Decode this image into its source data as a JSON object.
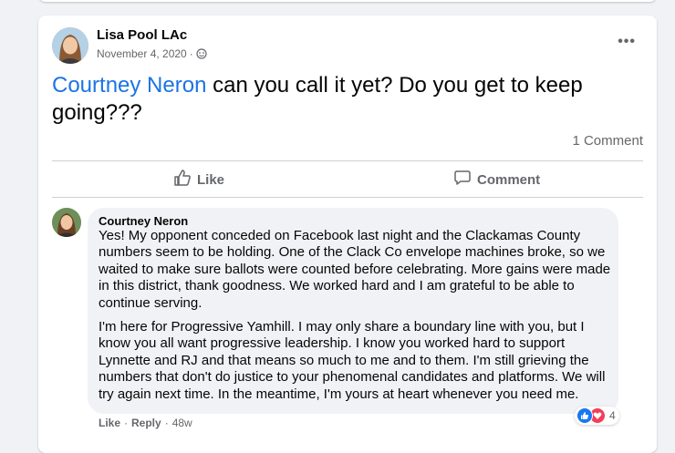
{
  "post": {
    "author": "Lisa Pool LAc",
    "date": "November 4, 2020",
    "date_separator": "·",
    "privacy_icon": "globe-icon",
    "more_label": "•••",
    "mention": "Courtney Neron",
    "text": " can you call it yet? Do you get to keep going???",
    "comment_count": "1 Comment"
  },
  "actions": {
    "like_label": "Like",
    "comment_label": "Comment"
  },
  "comment": {
    "author": "Courtney Neron",
    "paragraphs": [
      "Yes! My opponent conceded on Facebook last night and the Clackamas County numbers seem to be holding. One of the Clack Co envelope machines broke, so we waited to make sure ballots were counted before celebrating. More gains were made in this district, thank goodness. We worked hard and I am grateful to be able to continue serving.",
      "I'm here for Progressive Yamhill. I may only share a boundary line with you, but I know you all want progressive leadership. I know you worked hard to support Lynnette and RJ and that means so much to me and to them. I'm still grieving the numbers that don't do justice to your phenomenal candidates and platforms. We will try again next time. In the meantime, I'm yours at heart whenever you need me."
    ],
    "like_label": "Like",
    "reply_label": "Reply",
    "separator": "·",
    "age": "48w",
    "reaction_count": "4",
    "reaction_icons": [
      "like-icon",
      "love-icon"
    ]
  },
  "colors": {
    "accent": "#1b74e4",
    "like_blue": "#1877f2",
    "love_red": "#f33e58",
    "secondary_text": "#65676b"
  }
}
